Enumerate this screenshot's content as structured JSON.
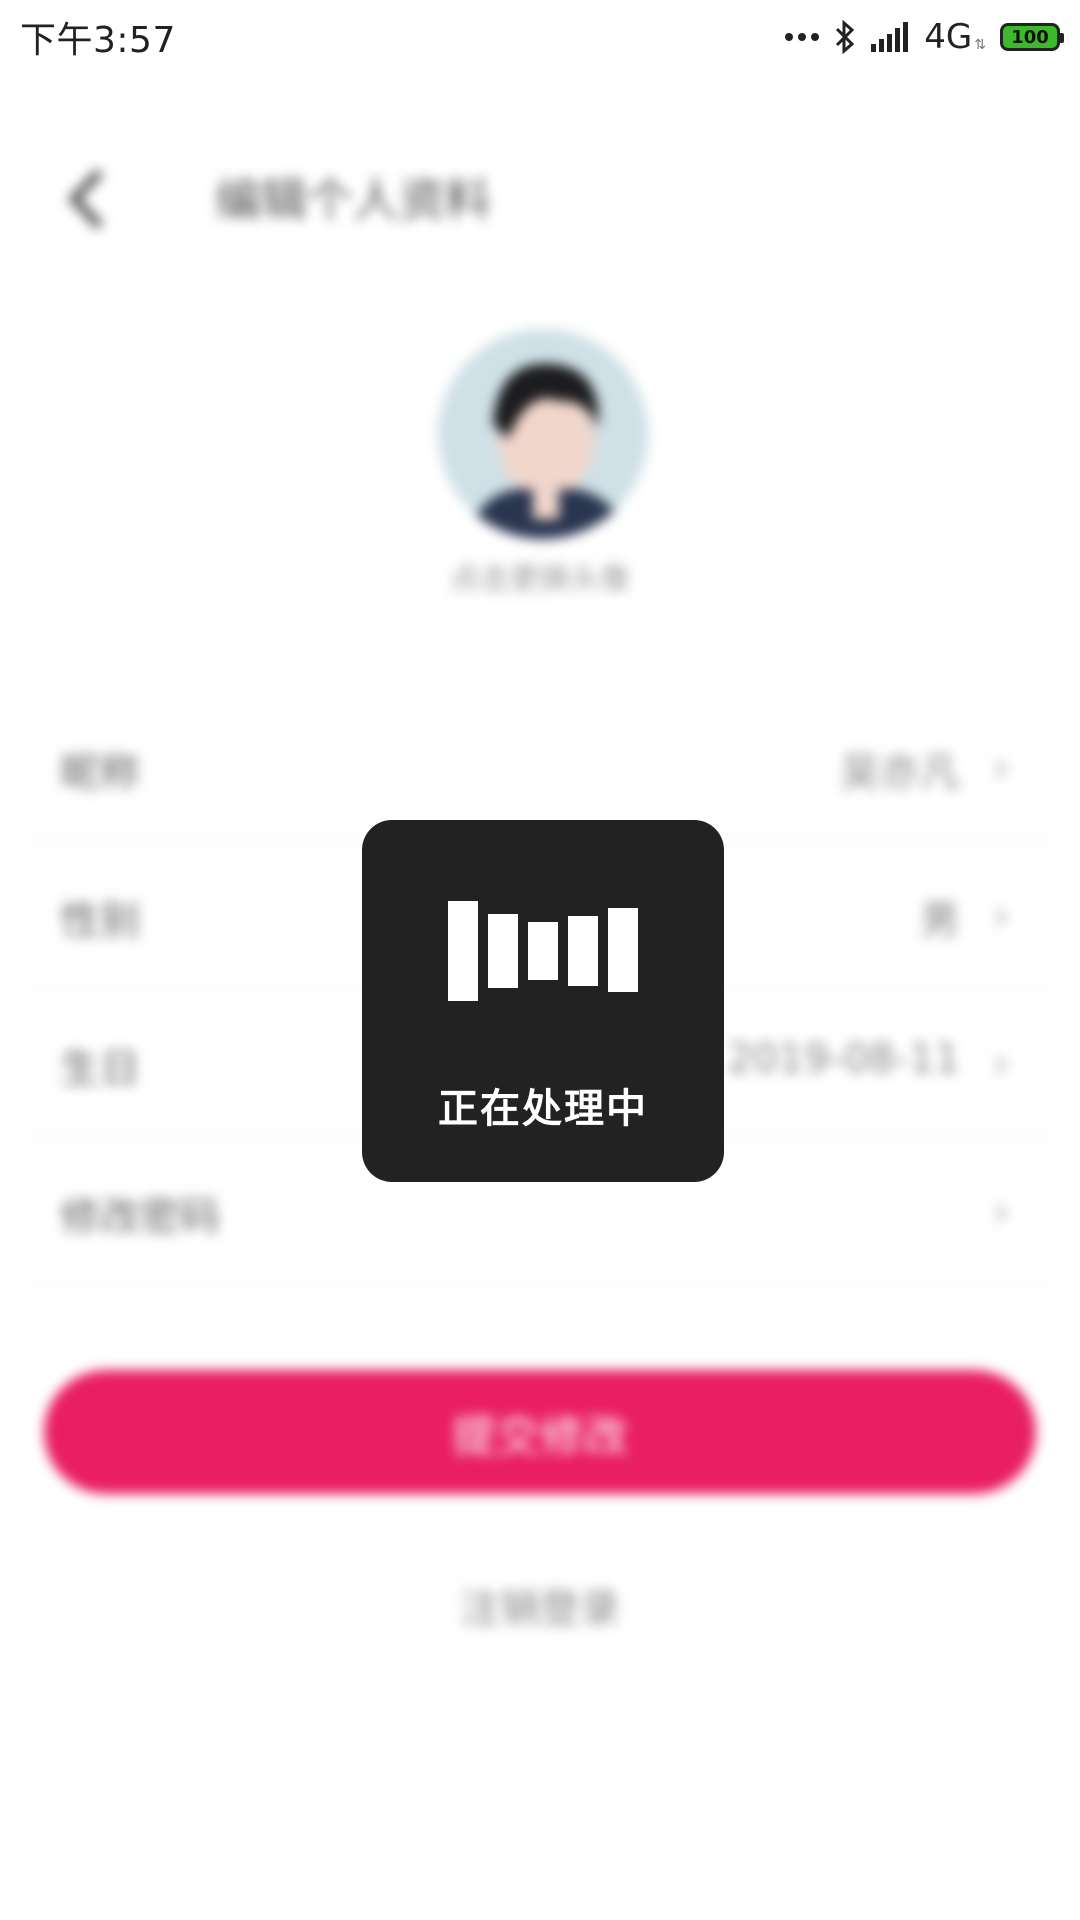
{
  "status_bar": {
    "time": "下午3:57",
    "network": "4G",
    "battery": "100"
  },
  "header": {
    "title": "编辑个人资料"
  },
  "profile": {
    "avatar_hint": "点击更换头像"
  },
  "form": {
    "rows": [
      {
        "label": "昵称",
        "value": "吴亦凡"
      },
      {
        "label": "性别",
        "value": "男"
      },
      {
        "label": "生日",
        "value": "2019-08-11"
      },
      {
        "label": "修改密码",
        "value": ""
      }
    ]
  },
  "actions": {
    "submit_label": "提交修改",
    "logout_label": "注销登录"
  },
  "loading": {
    "text": "正在处理中"
  },
  "colors": {
    "accent": "#e91e63",
    "toast_bg": "#222222",
    "battery": "#3cba2a"
  }
}
